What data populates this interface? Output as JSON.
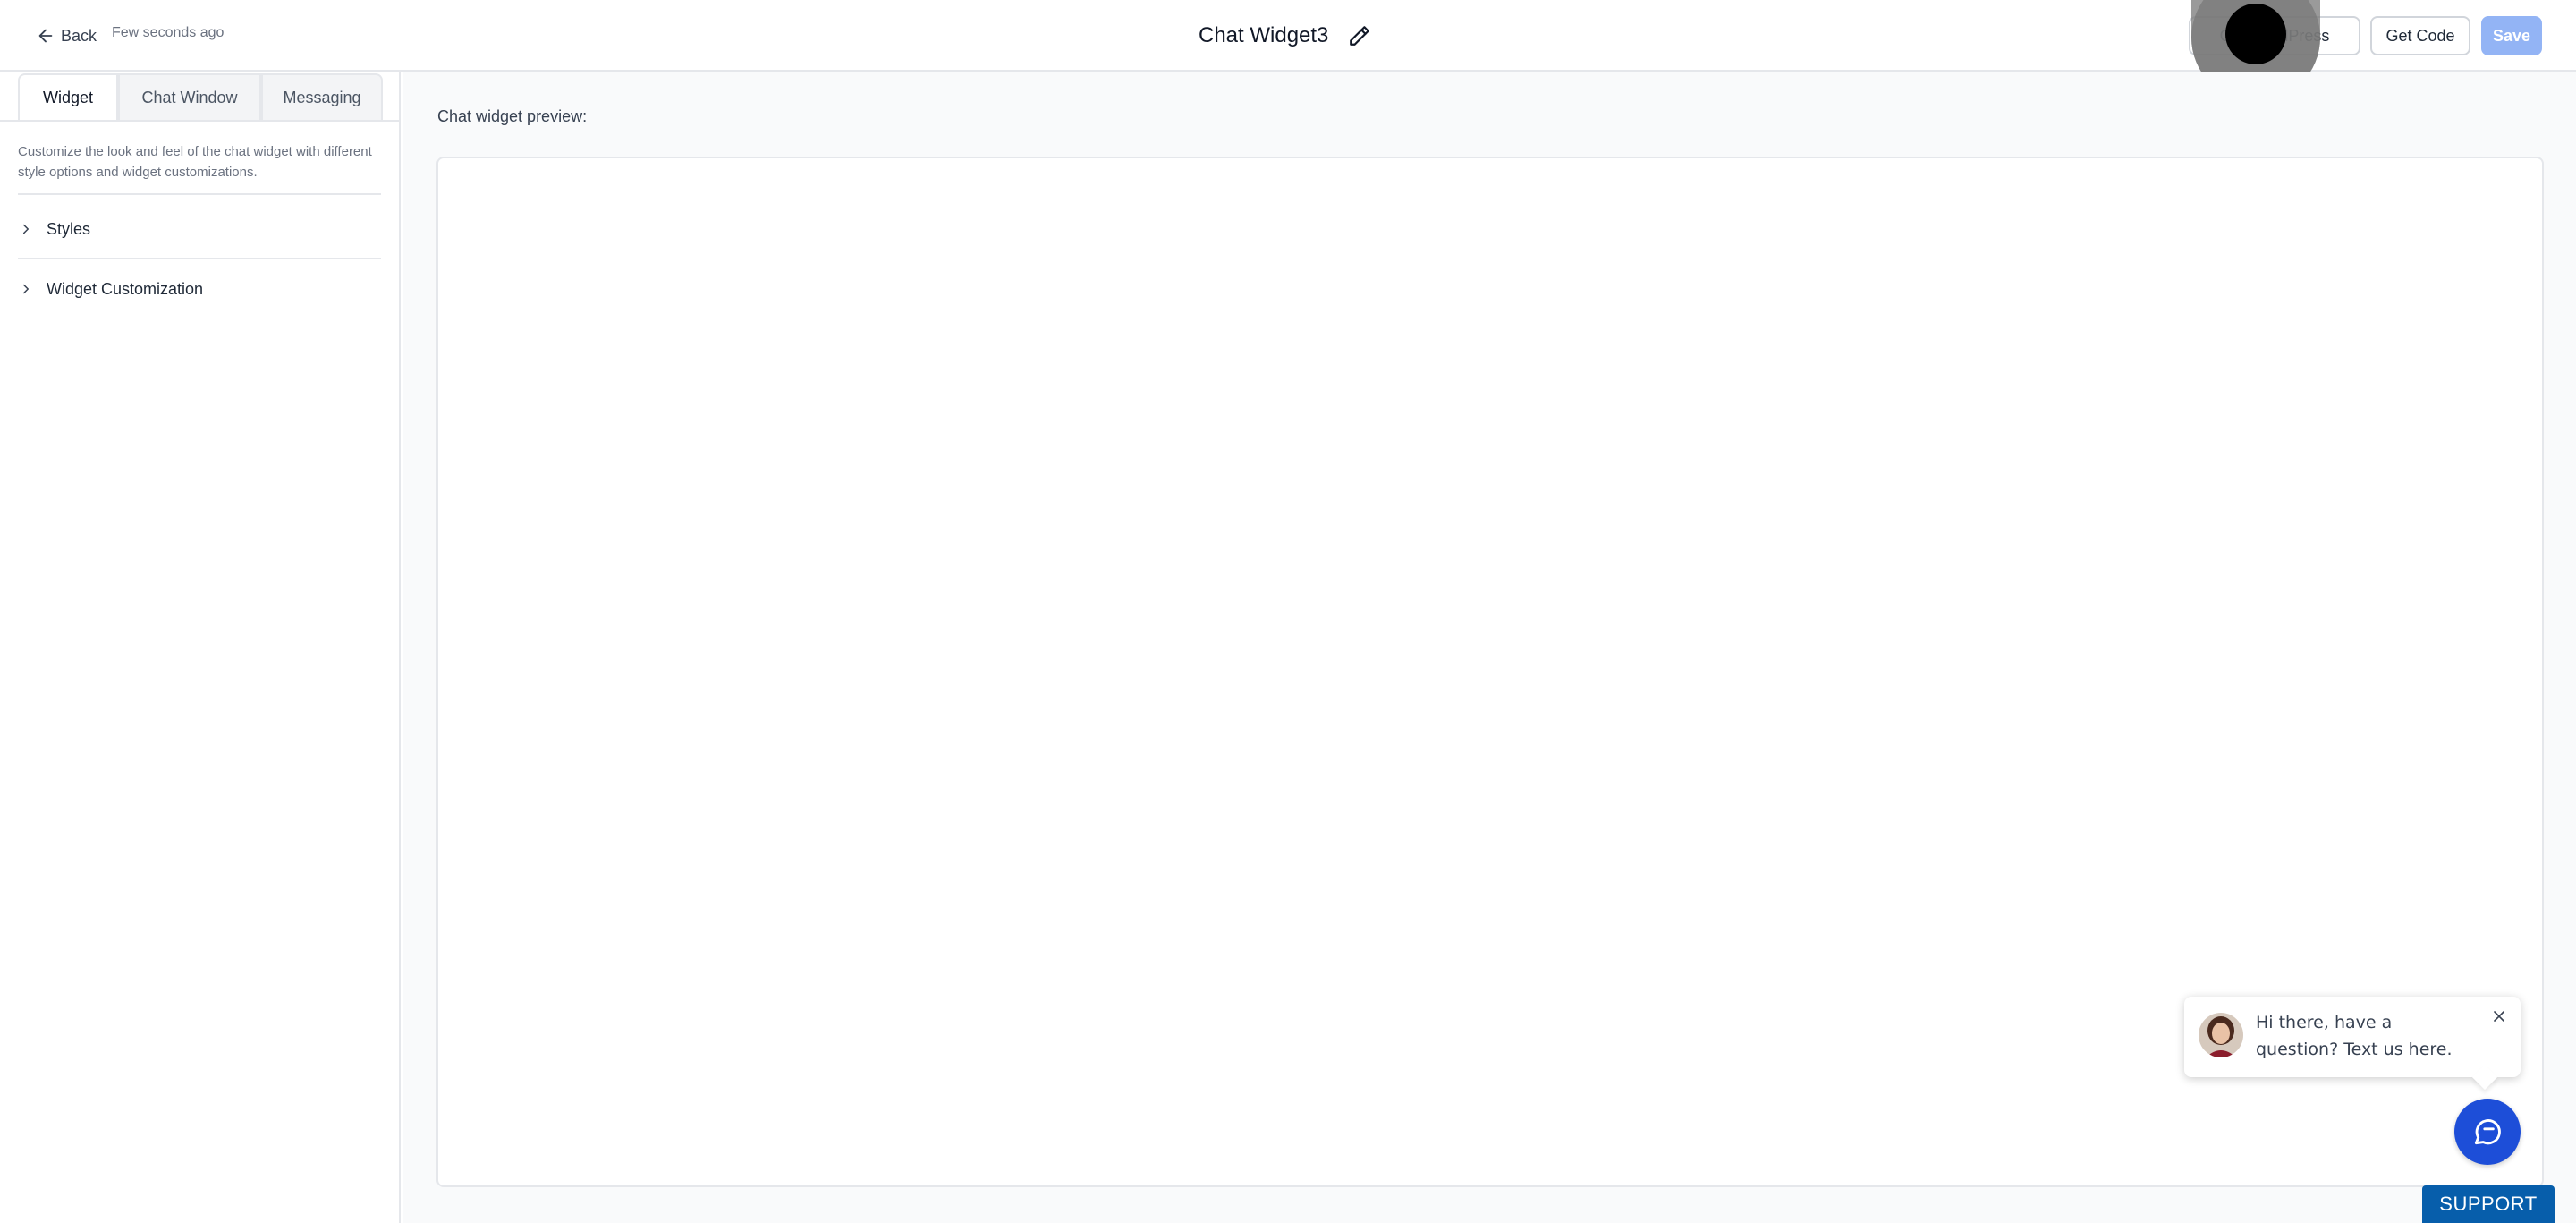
{
  "header": {
    "back_label": "Back",
    "saved_status": "Few seconds ago",
    "title": "Chat Widget3",
    "buttons": {
      "wordpress": "Get WordPress",
      "code": "Get Code",
      "save": "Save"
    }
  },
  "sidebar": {
    "tabs": [
      {
        "label": "Widget",
        "active": true
      },
      {
        "label": "Chat Window",
        "active": false
      },
      {
        "label": "Messaging",
        "active": false
      }
    ],
    "description": "Customize the look and feel of the chat widget with different style options and widget customizations.",
    "sections": [
      {
        "label": "Styles",
        "icon": "chevron-right-icon"
      },
      {
        "label": "Widget Customization",
        "icon": "chevron-right-icon"
      }
    ]
  },
  "main": {
    "preview_label": "Chat widget preview:"
  },
  "widget": {
    "greeting": "Hi there, have a question? Text us here.",
    "support_label": "SUPPORT",
    "colors": {
      "fab": "#1d4ed8",
      "support": "#075eab",
      "save_disabled": "#93b4f5"
    }
  }
}
